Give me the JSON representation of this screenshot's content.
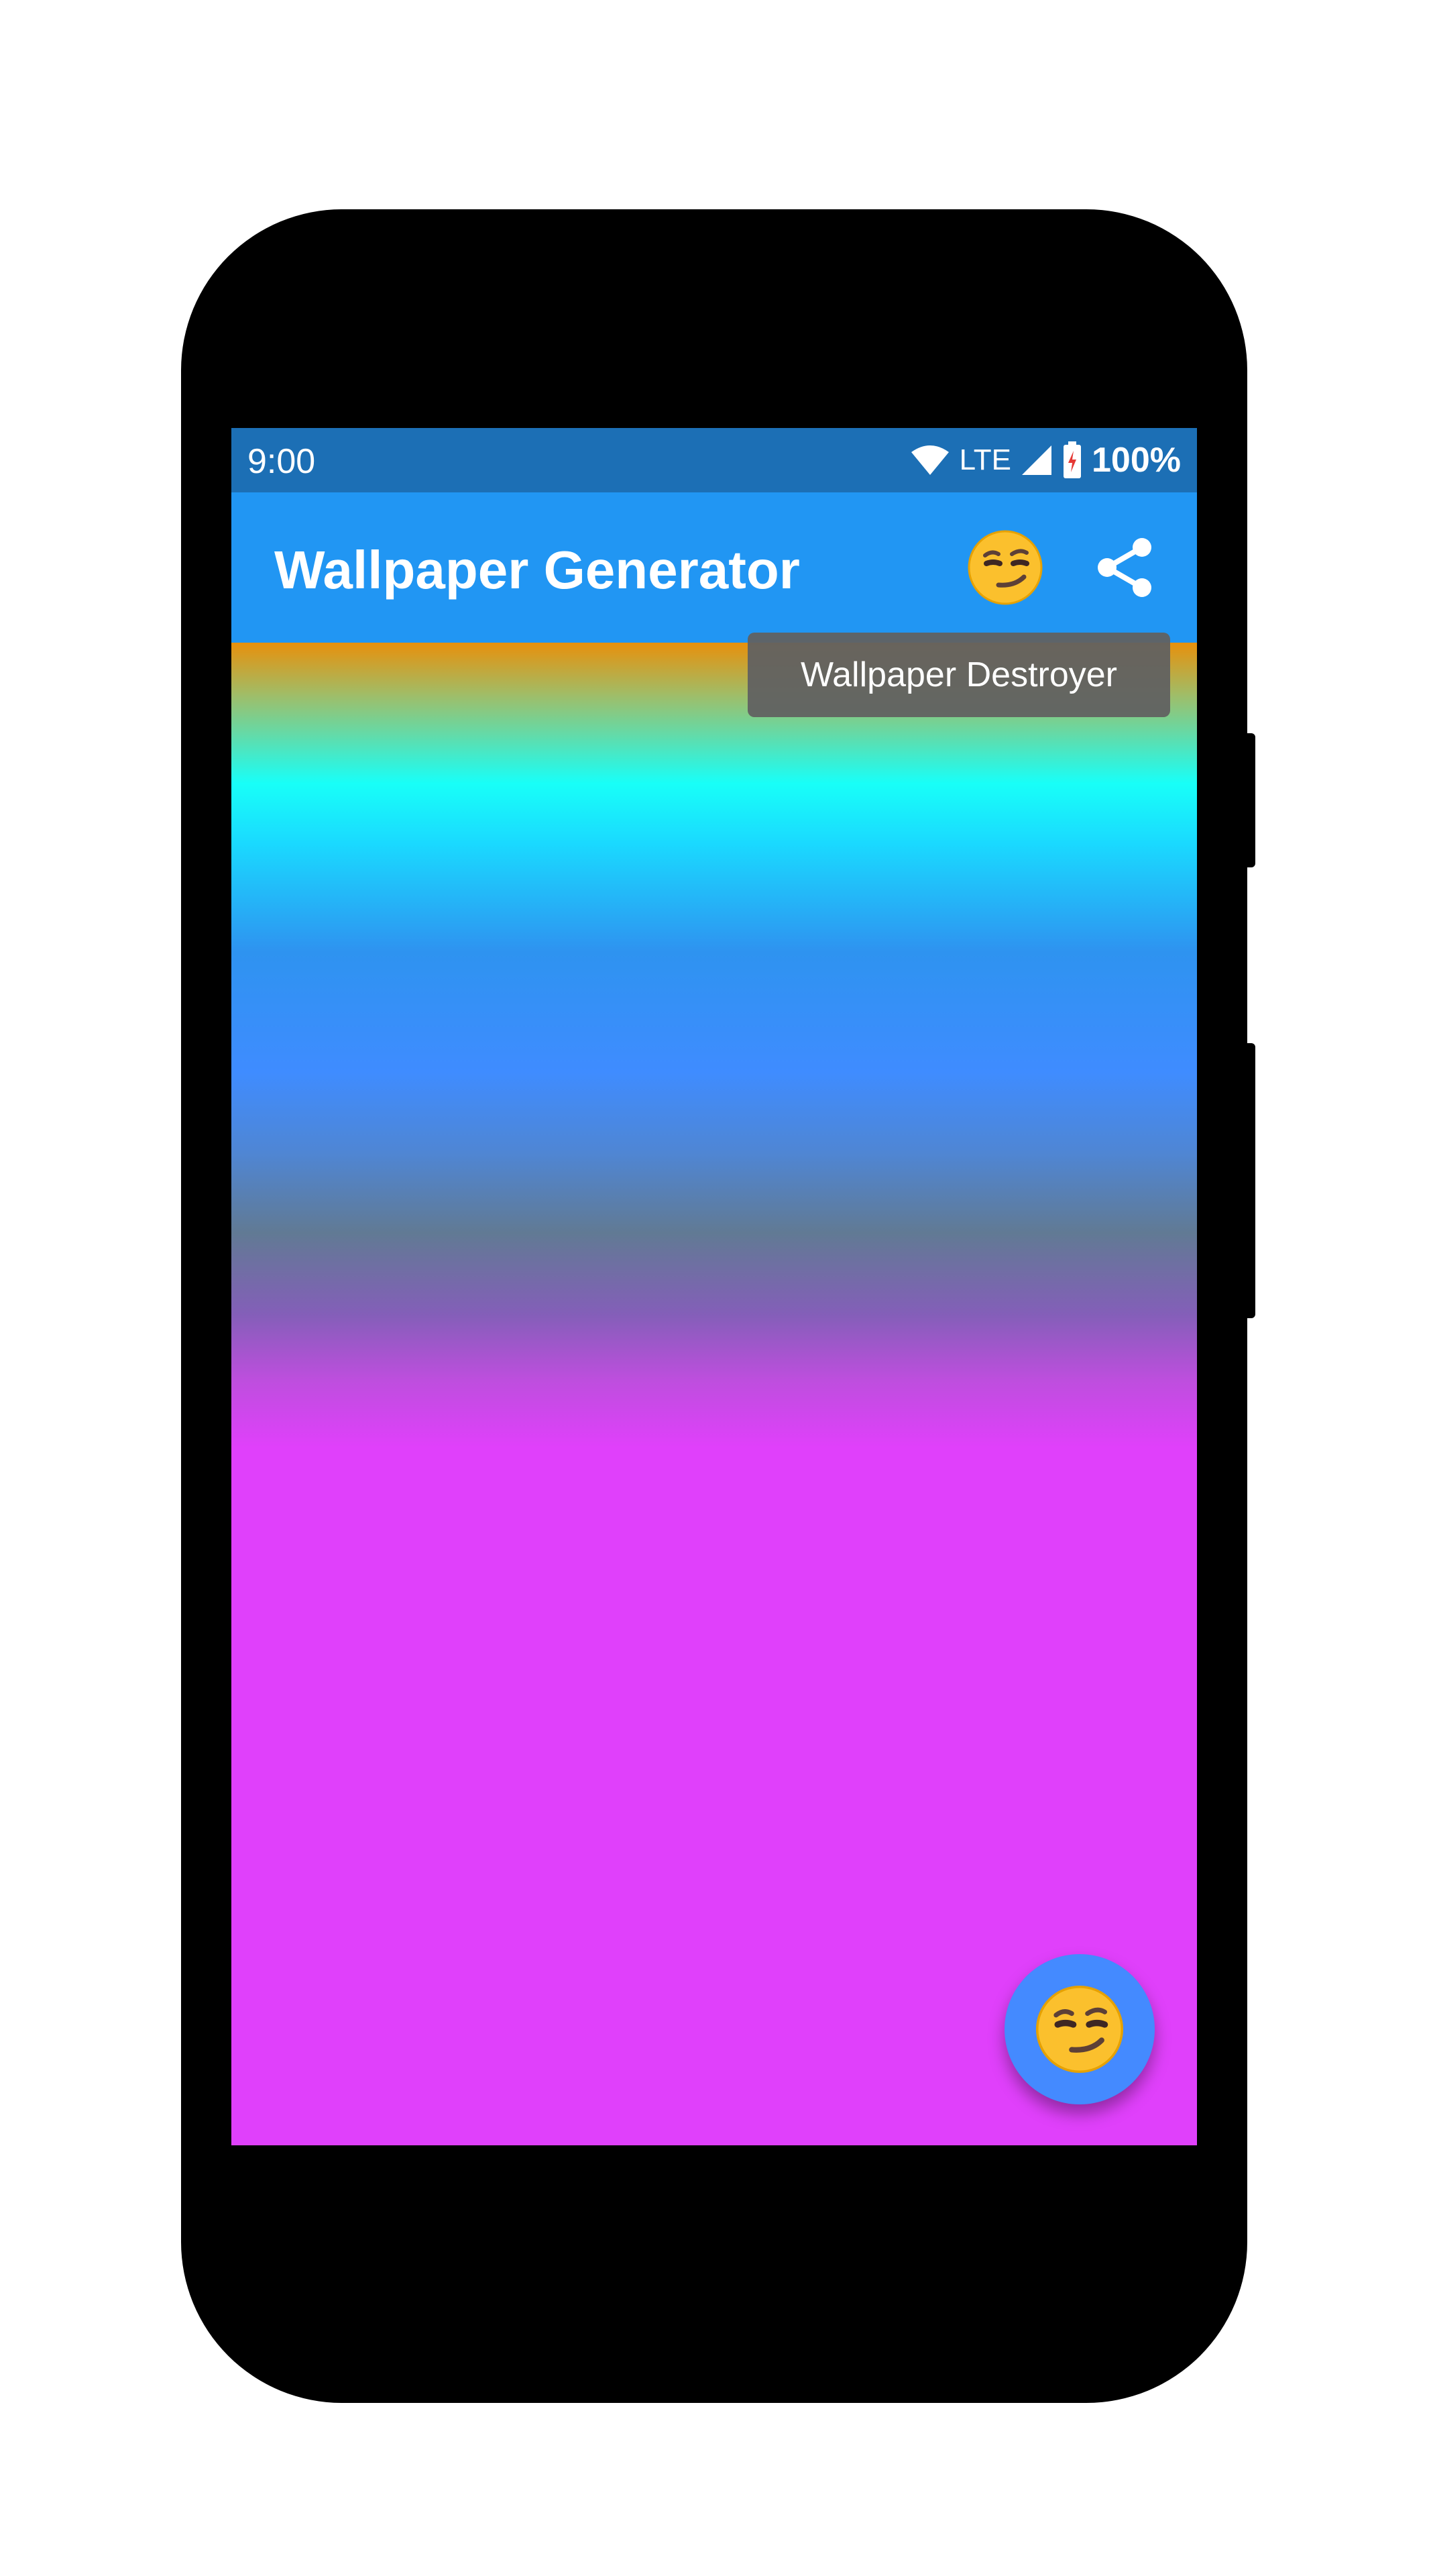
{
  "status_bar": {
    "time": "9:00",
    "network": "LTE",
    "battery": "100%",
    "icons": [
      "wifi-icon",
      "signal-icon",
      "battery-charging-icon"
    ]
  },
  "app_bar": {
    "title": "Wallpaper Generator",
    "actions": [
      {
        "icon": "smirking-face-emoji-icon"
      },
      {
        "icon": "share-icon"
      }
    ]
  },
  "tooltip": {
    "text": "Wallpaper Destroyer"
  },
  "fab": {
    "icon": "smirking-face-emoji-icon"
  },
  "colors": {
    "status_bar": "#1c6fb5",
    "app_bar": "#2196f3",
    "fab": "#448aff",
    "tooltip": "#616161",
    "gradient_top": "#e8900c",
    "gradient_cyan": "#18fff8",
    "gradient_blue": "#3f8cff",
    "gradient_magenta": "#e040fb"
  }
}
